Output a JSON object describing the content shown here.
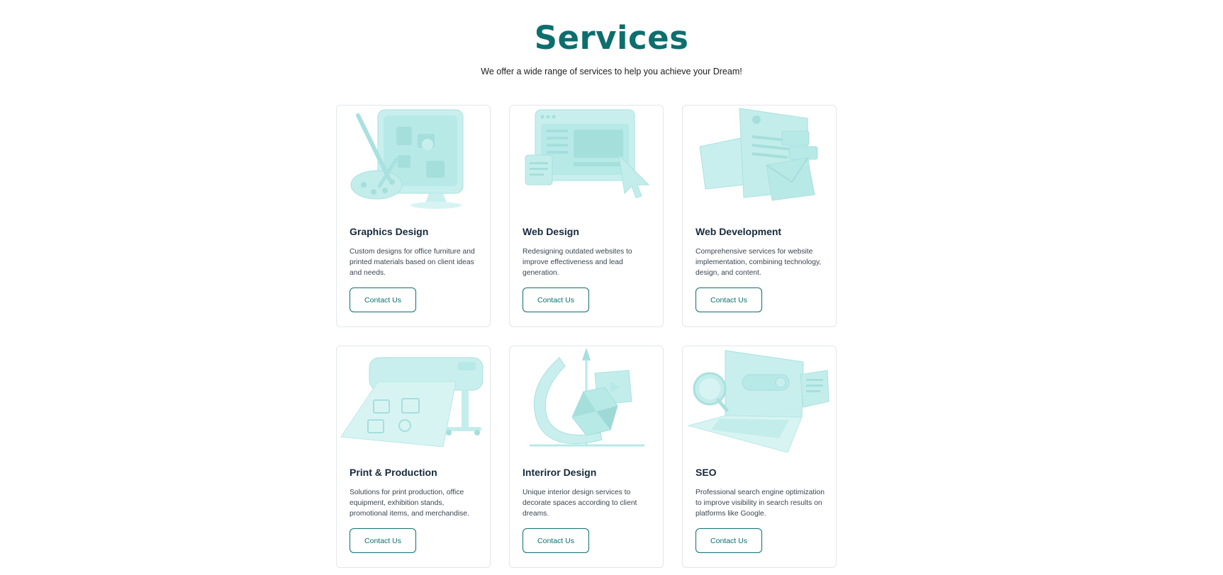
{
  "header": {
    "title": "Services",
    "subtitle": "We offer a wide range of services to help you achieve your Dream!"
  },
  "theme": {
    "accent": "#0d6e6e",
    "illustration": "#a9e4e2",
    "border": "#e3e6ea"
  },
  "services": [
    {
      "title": "Graphics Design",
      "description": "Custom designs for office furniture and printed materials based on client ideas and needs.",
      "button_label": "Contact Us",
      "icon": "graphics-design-illustration"
    },
    {
      "title": "Web Design",
      "description": "Redesigning outdated websites to improve effectiveness and lead generation.",
      "button_label": "Contact Us",
      "icon": "web-design-illustration"
    },
    {
      "title": "Web Development",
      "description": "Comprehensive services for website implementation, combining technology, design, and content.",
      "button_label": "Contact Us",
      "icon": "web-development-illustration"
    },
    {
      "title": "Print & Production",
      "description": "Solutions for print production, office equipment, exhibition stands, promotional items, and merchandise.",
      "button_label": "Contact Us",
      "icon": "print-production-illustration"
    },
    {
      "title": "Interiror Design",
      "description": "Unique interior design services to decorate spaces according to client dreams.",
      "button_label": "Contact Us",
      "icon": "interior-design-illustration"
    },
    {
      "title": "SEO",
      "description": "Professional search engine optimization to improve visibility in search results on platforms like Google.",
      "button_label": "Contact Us",
      "icon": "seo-illustration"
    }
  ]
}
